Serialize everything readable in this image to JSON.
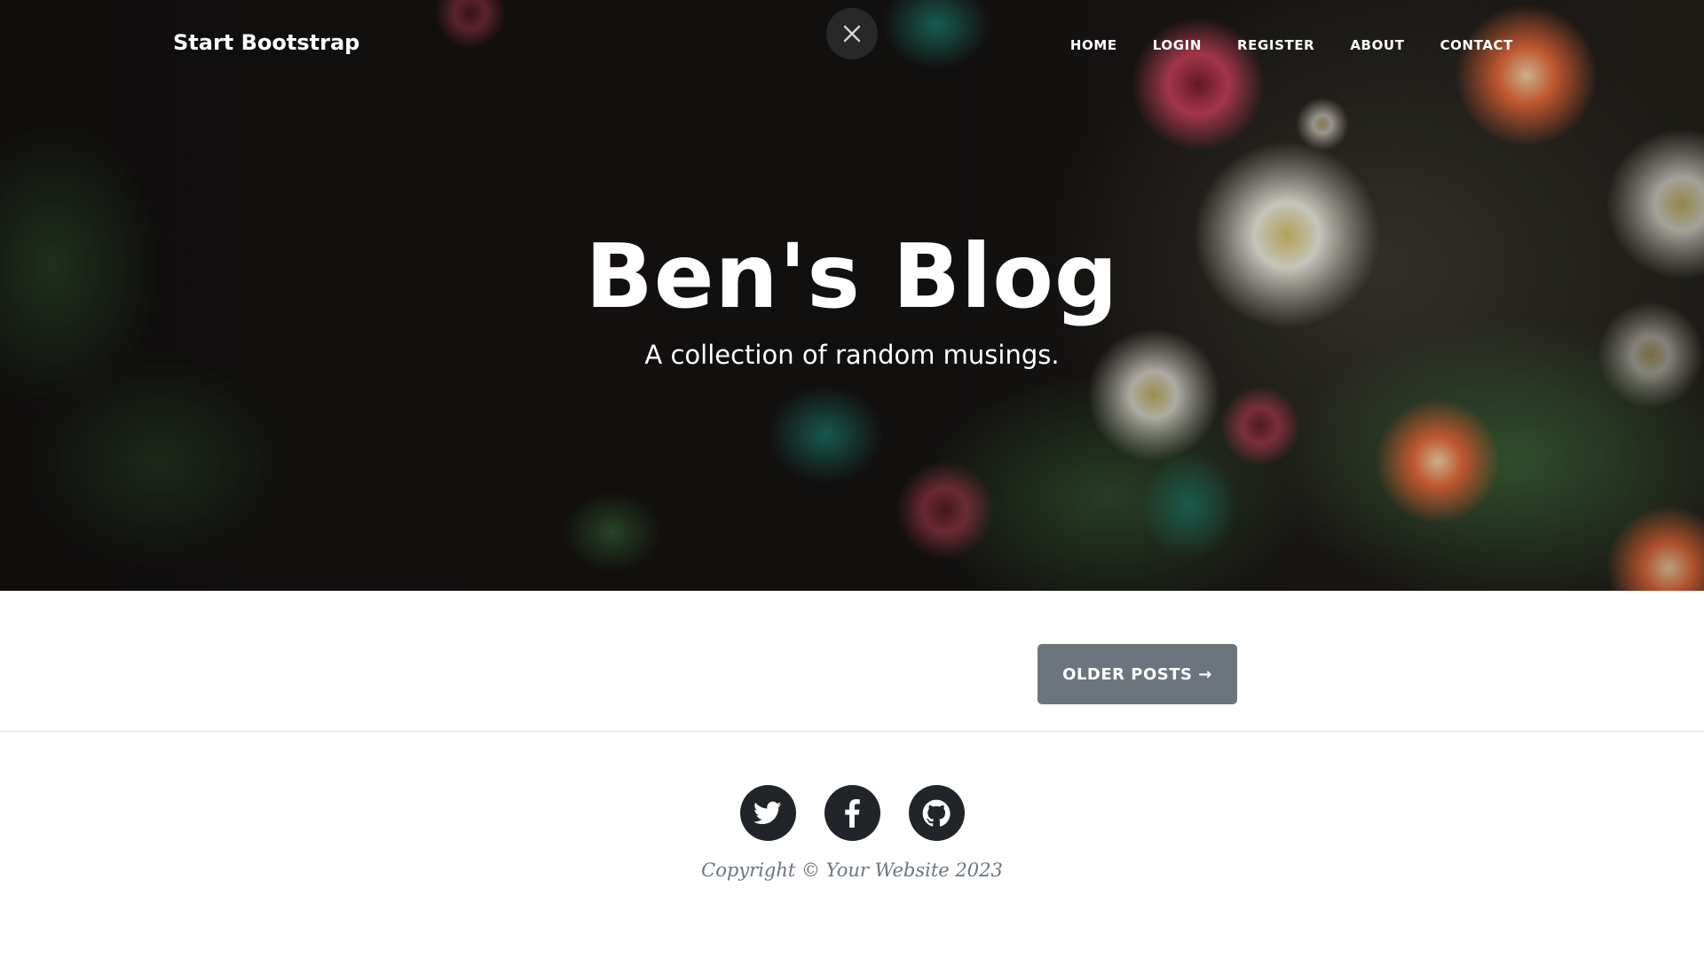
{
  "navbar": {
    "brand": "Start Bootstrap",
    "links": [
      "HOME",
      "LOGIN",
      "REGISTER",
      "ABOUT",
      "CONTACT"
    ],
    "close_icon": "close-icon"
  },
  "hero": {
    "title": "Ben's Blog",
    "subtitle": "A collection of random musings."
  },
  "pager": {
    "older_label": "OLDER POSTS →"
  },
  "footer": {
    "social": [
      "twitter-icon",
      "facebook-icon",
      "github-icon"
    ],
    "copyright": "Copyright © Your Website 2023"
  },
  "colors": {
    "button_gray": "#6c757d",
    "social_dark": "#212529",
    "text_muted": "#6c757d"
  }
}
